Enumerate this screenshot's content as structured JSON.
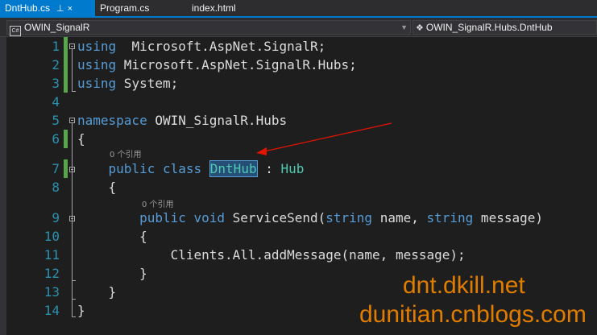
{
  "tabs": [
    {
      "label": "DntHub.cs",
      "active": true,
      "pin": "⊥",
      "close": "×"
    },
    {
      "label": "Program.cs",
      "active": false
    },
    {
      "label": "index.html",
      "active": false
    }
  ],
  "navbar": {
    "project_icon": "C#",
    "project": "OWIN_SignalR",
    "type_icon": "class-icon",
    "type": "OWIN_SignalR.Hubs.DntHub"
  },
  "code_lens": {
    "class_refs": "0 个引用",
    "method_refs": "0 个引用"
  },
  "lines": [
    {
      "n": "1",
      "tokens": [
        [
          "kw",
          "using"
        ],
        [
          "",
          "  Microsoft.AspNet.SignalR;"
        ]
      ]
    },
    {
      "n": "2",
      "tokens": [
        [
          "kw",
          "using"
        ],
        [
          "",
          " Microsoft.AspNet.SignalR.Hubs;"
        ]
      ]
    },
    {
      "n": "3",
      "tokens": [
        [
          "kw",
          "using"
        ],
        [
          "",
          " System;"
        ]
      ]
    },
    {
      "n": "4",
      "tokens": []
    },
    {
      "n": "5",
      "tokens": [
        [
          "kw",
          "namespace"
        ],
        [
          "",
          " OWIN_SignalR.Hubs"
        ]
      ]
    },
    {
      "n": "6",
      "tokens": [
        [
          "",
          "{"
        ]
      ]
    },
    {
      "n": "7",
      "tokens": [
        [
          "",
          "    "
        ],
        [
          "kw",
          "public"
        ],
        [
          "",
          " "
        ],
        [
          "kw",
          "class"
        ],
        [
          "",
          " "
        ],
        [
          "hl",
          "DntHub"
        ],
        [
          "",
          " : "
        ],
        [
          "ty",
          "Hub"
        ]
      ]
    },
    {
      "n": "8",
      "tokens": [
        [
          "",
          "    {"
        ]
      ]
    },
    {
      "n": "9",
      "tokens": [
        [
          "",
          "        "
        ],
        [
          "kw",
          "public"
        ],
        [
          "",
          " "
        ],
        [
          "kw",
          "void"
        ],
        [
          "",
          " ServiceSend("
        ],
        [
          "kw",
          "string"
        ],
        [
          "",
          " name, "
        ],
        [
          "kw",
          "string"
        ],
        [
          "",
          " message)"
        ]
      ]
    },
    {
      "n": "10",
      "tokens": [
        [
          "",
          "        {"
        ]
      ]
    },
    {
      "n": "11",
      "tokens": [
        [
          "",
          "            Clients.All.addMessage(name, message);"
        ]
      ]
    },
    {
      "n": "12",
      "tokens": [
        [
          "",
          "        }"
        ]
      ]
    },
    {
      "n": "13",
      "tokens": [
        [
          "",
          "    }"
        ]
      ]
    },
    {
      "n": "14",
      "tokens": [
        [
          "",
          "}"
        ]
      ]
    }
  ],
  "watermark": {
    "line1": "dnt.dkill.net",
    "line2": "dunitian.cnblogs.com"
  },
  "colors": {
    "accent": "#007acc",
    "keyword": "#569cd6",
    "type": "#4ec9b0",
    "line_number": "#2b91af",
    "change_bar": "#57a64a",
    "arrow": "#e51400",
    "watermark": "#e07c00"
  }
}
